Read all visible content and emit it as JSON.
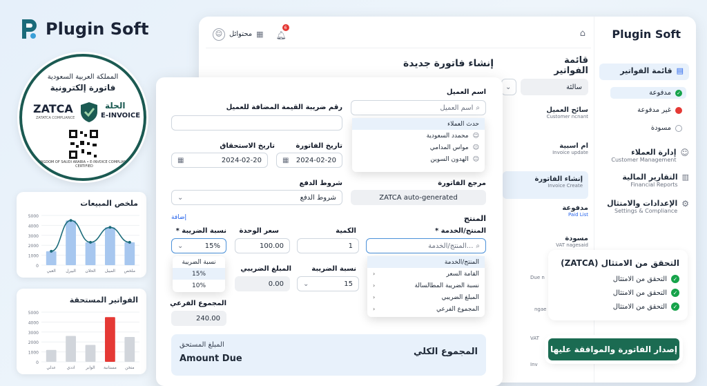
{
  "brand": {
    "name": "Plugin Soft"
  },
  "badge": {
    "line1": "المملكة العربية السعودية",
    "line2": "فاتورة إلكترونية",
    "zatca": "ZATCA",
    "zatca_sub": "ZATATCA COMPLIANCE",
    "ar_word": "الحلة",
    "einvoice": "E-INVOICE",
    "ring": "KINGDOM OF SAUDI ARABIA • E-INVOICE COMPLIANCE CERTIFIED"
  },
  "sales_chart": {
    "title": "ملخص المبيعات"
  },
  "due_chart": {
    "title": "الفواتير المستحقة"
  },
  "chart_data": [
    {
      "type": "bar",
      "title": "ملخص المبيعات",
      "categories": [
        "العبي",
        "البيرل",
        "الحلان",
        "الميبل",
        "ملخص"
      ],
      "values": [
        1400,
        4500,
        2300,
        3800,
        2300
      ],
      "line": [
        1400,
        4500,
        2300,
        3800,
        2300
      ],
      "ylim": [
        0,
        5000
      ],
      "yticks": [
        "5000",
        "4000",
        "3000",
        "2000",
        "1000",
        "0"
      ]
    },
    {
      "type": "bar",
      "title": "الفواتير المستحقة",
      "categories": [
        "عدلي",
        "اددي",
        "الوابر",
        "مستانبة",
        "متخن"
      ],
      "values": [
        1200,
        2600,
        1700,
        4500,
        2500
      ],
      "highlight_index": 3,
      "ylim": [
        0,
        5000
      ],
      "yticks": [
        "5000",
        "4000",
        "3000",
        "2000",
        "1000",
        "0"
      ]
    }
  ],
  "topbar": {
    "user": "محتوائل",
    "notif_count": "6"
  },
  "sidebar": {
    "brand": "Plugin Soft",
    "invoices": "قائمة الفواتير",
    "paid": "مدفوعة",
    "unpaid": "غير مدفوعة",
    "draft": "مسودة",
    "customers": "إدارة العملاء",
    "customers_sub": "Customer Management",
    "reports": "التقارير المالية",
    "reports_sub": "Financial Reports",
    "settings": "الإعدادات والامتثال",
    "settings_sub": "Settings & Compliance"
  },
  "list": {
    "title": "قائمة الفواتير",
    "filter": "سالئة",
    "row1": "سائح العميل",
    "row1_sub": "Customer ncnant",
    "row2": "ام اسبية",
    "row2_sub": "Invoice update",
    "row3": "إنشاء الفاتورة",
    "row3_sub": "Invoice Create",
    "row4": "مدفوعة",
    "row4_sub": "Paid List",
    "row5": "مسودة",
    "row5_sub": "VAT nagesaid",
    "row6_sub": "Due n",
    "row7_sub": "ngae",
    "row8_sub": "VAT",
    "row9_sub": "Inv"
  },
  "form": {
    "page_title": "إنشاء فاتورة جديدة",
    "customer_label": "اسم العميل",
    "customer_placeholder": "اسم العميل",
    "customer_options": [
      "حدث العملاء",
      "محمدد السعودية",
      "مواس المدامي",
      "الهدون السوين"
    ],
    "vat_label": "رقم ضريبة القيمة المضافة للعميل",
    "invoice_date_label": "تاريخ الفاتورة",
    "invoice_date": "2024-02-20",
    "due_date_label": "تاريخ الاستحقاق",
    "due_date": "2024-02-20",
    "ref_label": "مرجع الفاتورة",
    "ref_value": "ZATCA auto-generated",
    "terms_label": "شروط الدفع",
    "terms_value": "شروط الدفع",
    "product_section": "المنتج",
    "add_link": "إضافة",
    "product_label": "المنتج/الخدمة *",
    "product_placeholder": "المنتج/الخدمة...",
    "product_options": [
      "المنتج/الخدمة",
      "القامة السعر",
      "نسبة الضريبة المطالسالة",
      "المبلغ الضريبي",
      "المجموع الفرعي"
    ],
    "qty_label": "الكمية",
    "qty_value": "1",
    "price_label": "سعر الوحدة",
    "price_value": "100.00",
    "tax_rate_label": "نسبة الضريبة *",
    "tax_rate_value": "15%",
    "tax_options": [
      "نسبة الضريبة",
      "15%",
      "10%"
    ],
    "tax_rate2_label": "نسبة الضريبة",
    "tax_rate2_value": "15",
    "tax_amount_label": "المبلغ الضريبي",
    "tax_amount_value": "0.00",
    "subtotal_label": "المجموع الفرعي",
    "subtotal_value": "240.00",
    "total_label": "المجموع الكلي",
    "amount_due_ar": "المبلغ المستحق",
    "amount_due_en": "Amount Due"
  },
  "zatca_card": {
    "title": "التحقق من الامتثال (ZATCA)",
    "rows": [
      "التحقق من الامتثال",
      "التحقق من الامتثال",
      "التحقق من الامتثال"
    ]
  },
  "issue_button": "إصدار الفاتورة والموافقة عليها",
  "colors": {
    "primary": "#1b6b52",
    "accent": "#4a90d9",
    "highlight": "#e53935"
  }
}
